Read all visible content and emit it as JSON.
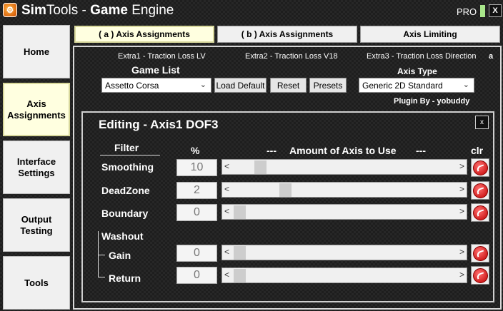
{
  "window": {
    "title_sim": "Sim",
    "title_tools": "Tools - ",
    "title_game": "Game",
    "title_engine": " Engine",
    "pro": "PRO",
    "close": "X"
  },
  "nav": {
    "home": "Home",
    "axis1": "Axis",
    "axis2": "Assignments",
    "interface1": "Interface",
    "interface2": "Settings",
    "output1": "Output",
    "output2": "Testing",
    "tools": "Tools"
  },
  "tabs": {
    "a": "( a ) Axis Assignments",
    "b": "( b ) Axis Assignments",
    "limiting": "Axis Limiting"
  },
  "extras": {
    "extra1": "Extra1 - Traction Loss LV",
    "extra2": "Extra2 - Traction Loss V18",
    "extra3": "Extra3 - Traction Loss Direction",
    "corner": "a"
  },
  "game_list": {
    "label": "Game List",
    "selected": "Assetto Corsa",
    "load_default": "Load Default",
    "reset": "Reset",
    "presets": "Presets"
  },
  "axis_type": {
    "label": "Axis Type",
    "selected": "Generic 2D Standard"
  },
  "plugin_by": "Plugin By - yobuddy",
  "editing": {
    "title": "Editing - Axis1 DOF3",
    "close": "x",
    "filter_header": "Filter",
    "percent_header": "%",
    "dash_left": "---",
    "amount_header": "Amount of Axis to Use",
    "dash_right": "---",
    "clr_header": "clr",
    "rows": {
      "smoothing": {
        "label": "Smoothing",
        "value": "10",
        "slider": 0.1
      },
      "deadzone": {
        "label": "DeadZone",
        "value": "2",
        "slider": 0.22
      },
      "boundary": {
        "label": "Boundary",
        "value": "0",
        "slider": 0.0
      },
      "gain": {
        "label": "Gain",
        "value": "0",
        "slider": 0.0
      },
      "return": {
        "label": "Return",
        "value": "0",
        "slider": 0.0
      }
    },
    "washout": "Washout"
  },
  "glyphs": {
    "left": "<",
    "right": ">",
    "chevron": "⌄"
  },
  "colors": {
    "clear_button": "#d00000",
    "active_tab": "#ffffe0"
  }
}
